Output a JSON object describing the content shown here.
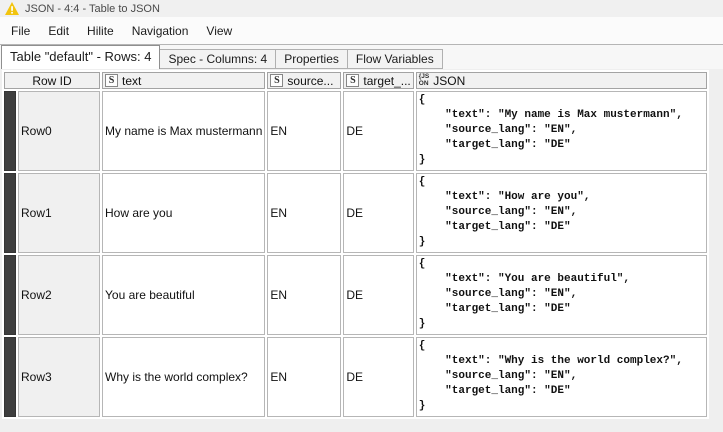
{
  "window": {
    "title": "JSON - 4:4 - Table to JSON"
  },
  "menu": {
    "file": "File",
    "edit": "Edit",
    "hilite": "Hilite",
    "navigation": "Navigation",
    "view": "View"
  },
  "tabs": {
    "table": "Table \"default\" - Rows: 4",
    "spec": "Spec - Columns: 4",
    "properties": "Properties",
    "flow_variables": "Flow Variables"
  },
  "table": {
    "columns": {
      "rowid": {
        "label": "Row ID"
      },
      "text": {
        "label": "text",
        "type_icon": "S"
      },
      "source": {
        "label": "source...",
        "type_icon": "S"
      },
      "target": {
        "label": "target_...",
        "type_icon": "S"
      },
      "json": {
        "label": "JSON",
        "type_icon": "{JS\nON"
      }
    },
    "rows": [
      {
        "id": "Row0",
        "text": "My name is Max mustermann",
        "source": "EN",
        "target": "DE",
        "json": "{\n    \"text\": \"My name is Max mustermann\",\n    \"source_lang\": \"EN\",\n    \"target_lang\": \"DE\"\n}"
      },
      {
        "id": "Row1",
        "text": "How are you",
        "source": "EN",
        "target": "DE",
        "json": "{\n    \"text\": \"How are you\",\n    \"source_lang\": \"EN\",\n    \"target_lang\": \"DE\"\n}"
      },
      {
        "id": "Row2",
        "text": "You are beautiful",
        "source": "EN",
        "target": "DE",
        "json": "{\n    \"text\": \"You are beautiful\",\n    \"source_lang\": \"EN\",\n    \"target_lang\": \"DE\"\n}"
      },
      {
        "id": "Row3",
        "text": "Why is the world complex?",
        "source": "EN",
        "target": "DE",
        "json": "{\n    \"text\": \"Why is the world complex?\",\n    \"source_lang\": \"EN\",\n    \"target_lang\": \"DE\"\n}"
      }
    ]
  },
  "colors": {
    "warning_yellow": "#f2c40d",
    "row_selector_dark": "#3e3e3e",
    "rowid_bg": "#f0f0f0",
    "grid_border": "#b6b6b6"
  }
}
